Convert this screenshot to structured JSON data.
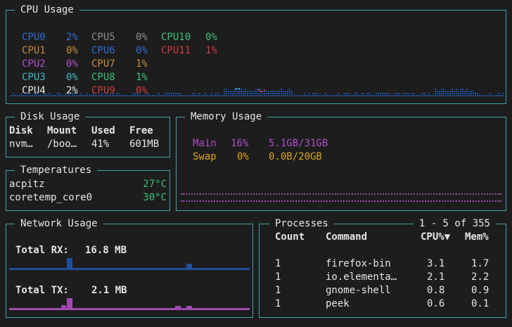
{
  "cpu": {
    "title": "CPU Usage",
    "cores": [
      {
        "name": "CPU0",
        "value": "2%",
        "color": "#2e6bd4"
      },
      {
        "name": "CPU1",
        "value": "0%",
        "color": "#c98a3c"
      },
      {
        "name": "CPU2",
        "value": "0%",
        "color": "#b04ec8"
      },
      {
        "name": "CPU3",
        "value": "0%",
        "color": "#3fb7c7"
      },
      {
        "name": "CPU4",
        "value": "2%",
        "color": "#e6e6e6"
      },
      {
        "name": "CPU5",
        "value": "0%",
        "color": "#8c8c8c"
      },
      {
        "name": "CPU6",
        "value": "0%",
        "color": "#2e6bd4"
      },
      {
        "name": "CPU7",
        "value": "1%",
        "color": "#c98a3c"
      },
      {
        "name": "CPU8",
        "value": "1%",
        "color": "#3fbf7a"
      },
      {
        "name": "CPU9",
        "value": "0%",
        "color": "#d23a3a"
      },
      {
        "name": "CPU10",
        "value": "0%",
        "color": "#3fbf7a"
      },
      {
        "name": "CPU11",
        "value": "1%",
        "color": "#d23a3a"
      }
    ]
  },
  "disk": {
    "title": "Disk Usage",
    "headers": [
      "Disk",
      "Mount",
      "Used",
      "Free"
    ],
    "rows": [
      [
        "nvm…",
        "/boo…",
        "41%",
        "601MB"
      ]
    ]
  },
  "temperatures": {
    "title": "Temperatures",
    "rows": [
      {
        "name": "acpitz",
        "value": "27°C"
      },
      {
        "name": "coretemp_core0",
        "value": "30°C"
      }
    ]
  },
  "memory": {
    "title": "Memory Usage",
    "main": {
      "label": "Main",
      "percent": "16%",
      "amount": "5.1GB/31GB",
      "color": "#b04ec8"
    },
    "swap": {
      "label": "Swap",
      "percent": "0%",
      "amount": "0.0B/20GB",
      "color": "#d9a520"
    }
  },
  "network": {
    "title": "Network Usage",
    "rx_label": "Total RX:",
    "rx_value": "16.8 MB",
    "tx_label": "Total TX:",
    "tx_value": "2.1 MB",
    "rx_color": "#1f4f9a",
    "tx_color": "#a04ab0"
  },
  "processes": {
    "title": "Processes",
    "range": "1 - 5 of 355",
    "headers": {
      "count": "Count",
      "command": "Command",
      "cpu": "CPU%▼",
      "mem": "Mem%"
    },
    "rows": [
      {
        "count": "1",
        "command": "firefox-bin",
        "cpu": "3.1",
        "mem": "1.7"
      },
      {
        "count": "1",
        "command": "io.elementa…",
        "cpu": "2.1",
        "mem": "2.2"
      },
      {
        "count": "1",
        "command": "gnome-shell",
        "cpu": "0.8",
        "mem": "0.9"
      },
      {
        "count": "1",
        "command": "peek",
        "cpu": "0.6",
        "mem": "0.1"
      }
    ]
  }
}
